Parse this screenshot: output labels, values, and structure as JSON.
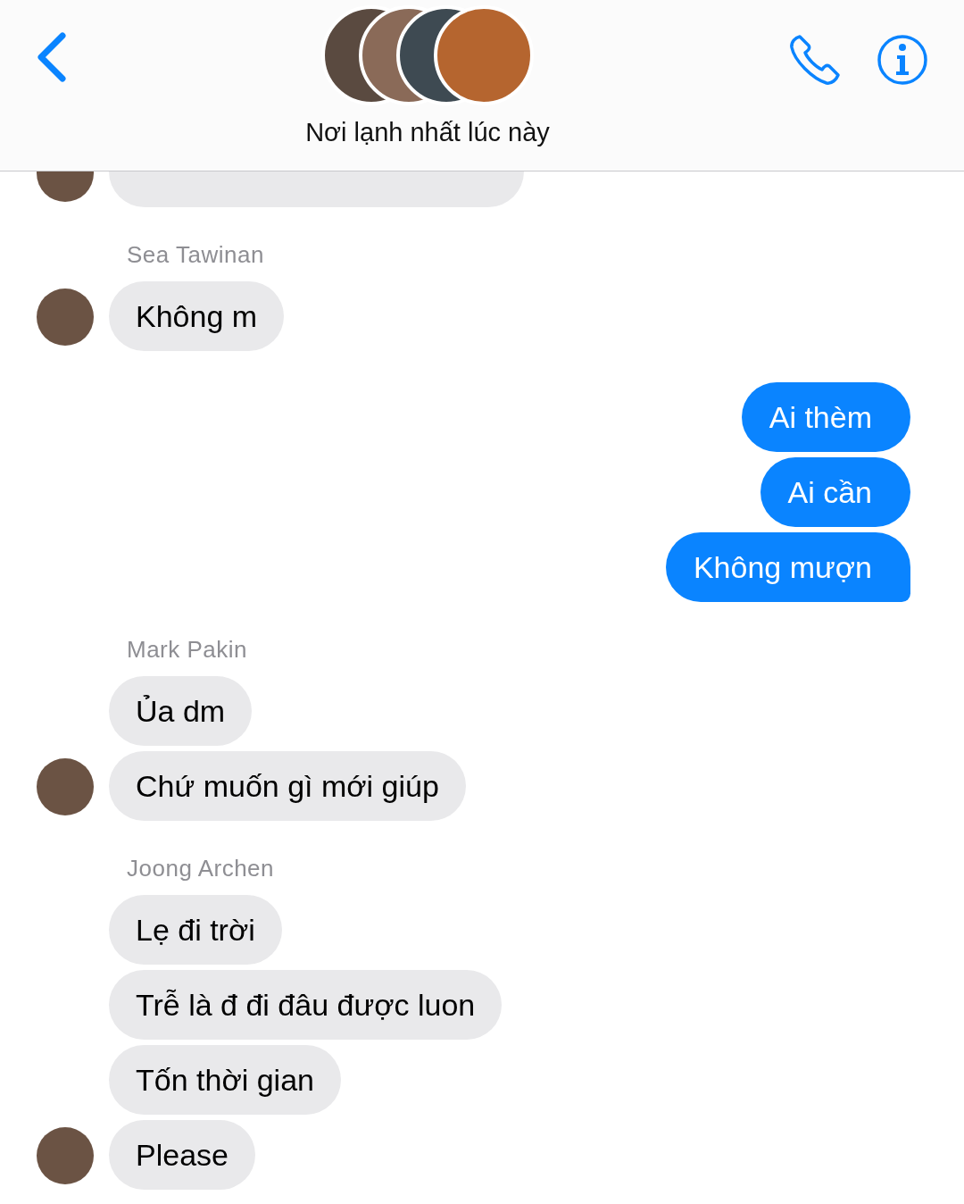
{
  "header": {
    "title": "Nơi lạnh nhất lúc này"
  },
  "messages": [
    {
      "kind": "cut"
    },
    {
      "kind": "sender",
      "text": "Sea Tawinan"
    },
    {
      "kind": "in",
      "text": "Không m",
      "avatar": true
    },
    {
      "kind": "out",
      "text": "Ai thèm",
      "tail": false
    },
    {
      "kind": "out",
      "text": "Ai cần",
      "tail": false
    },
    {
      "kind": "out",
      "text": "Không mượn",
      "tail": true
    },
    {
      "kind": "sender",
      "text": "Mark Pakin"
    },
    {
      "kind": "in",
      "text": "Ủa dm",
      "avatar": false
    },
    {
      "kind": "in",
      "text": "Chứ muốn gì mới giúp",
      "avatar": true
    },
    {
      "kind": "sender",
      "text": "Joong Archen"
    },
    {
      "kind": "in",
      "text": "Lẹ đi trời",
      "avatar": false
    },
    {
      "kind": "in",
      "text": "Trễ là đ đi đâu được luon",
      "avatar": false
    },
    {
      "kind": "in",
      "text": "Tốn thời gian",
      "avatar": false
    },
    {
      "kind": "in",
      "text": "Please",
      "avatar": true
    }
  ]
}
